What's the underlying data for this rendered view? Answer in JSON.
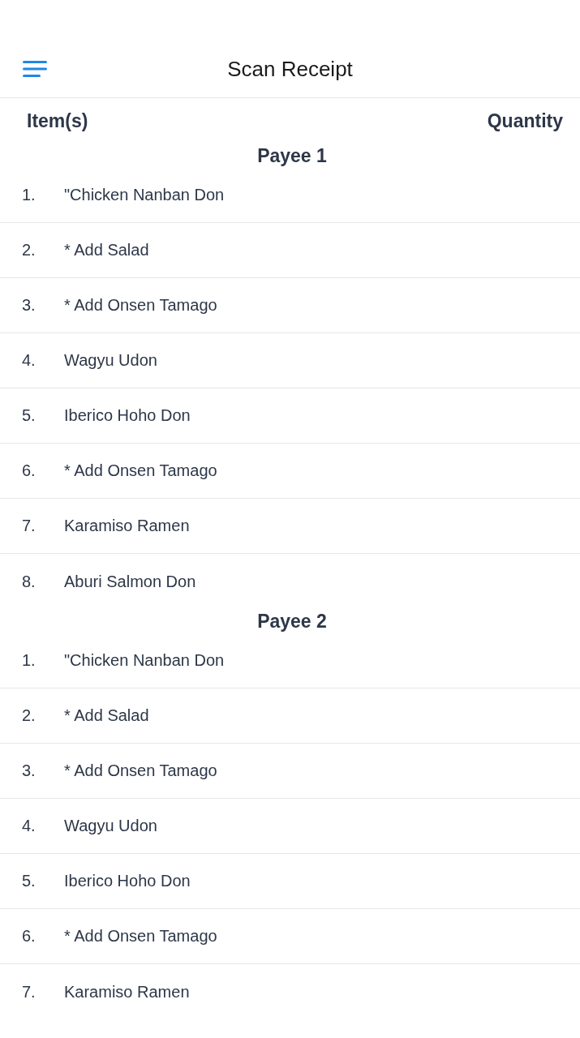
{
  "header": {
    "title": "Scan Receipt"
  },
  "columns": [
    "Item(s)",
    "Quantity"
  ],
  "groups": [
    {
      "payee": "Payee 1",
      "items": [
        {
          "number": "1.",
          "name": "\"Chicken Nanban Don"
        },
        {
          "number": "2.",
          "name": "* Add Salad"
        },
        {
          "number": "3.",
          "name": "* Add Onsen Tamago"
        },
        {
          "number": "4.",
          "name": "Wagyu Udon"
        },
        {
          "number": "5.",
          "name": "Iberico Hoho Don"
        },
        {
          "number": "6.",
          "name": "* Add Onsen Tamago"
        },
        {
          "number": "7.",
          "name": "Karamiso Ramen"
        },
        {
          "number": "8.",
          "name": "Aburi Salmon Don"
        }
      ]
    },
    {
      "payee": "Payee 2",
      "items": [
        {
          "number": "1.",
          "name": "\"Chicken Nanban Don"
        },
        {
          "number": "2.",
          "name": "* Add Salad"
        },
        {
          "number": "3.",
          "name": "* Add Onsen Tamago"
        },
        {
          "number": "4.",
          "name": "Wagyu Udon"
        },
        {
          "number": "5.",
          "name": "Iberico Hoho Don"
        },
        {
          "number": "6.",
          "name": "* Add Onsen Tamago"
        },
        {
          "number": "7.",
          "name": "Karamiso Ramen"
        }
      ]
    }
  ]
}
